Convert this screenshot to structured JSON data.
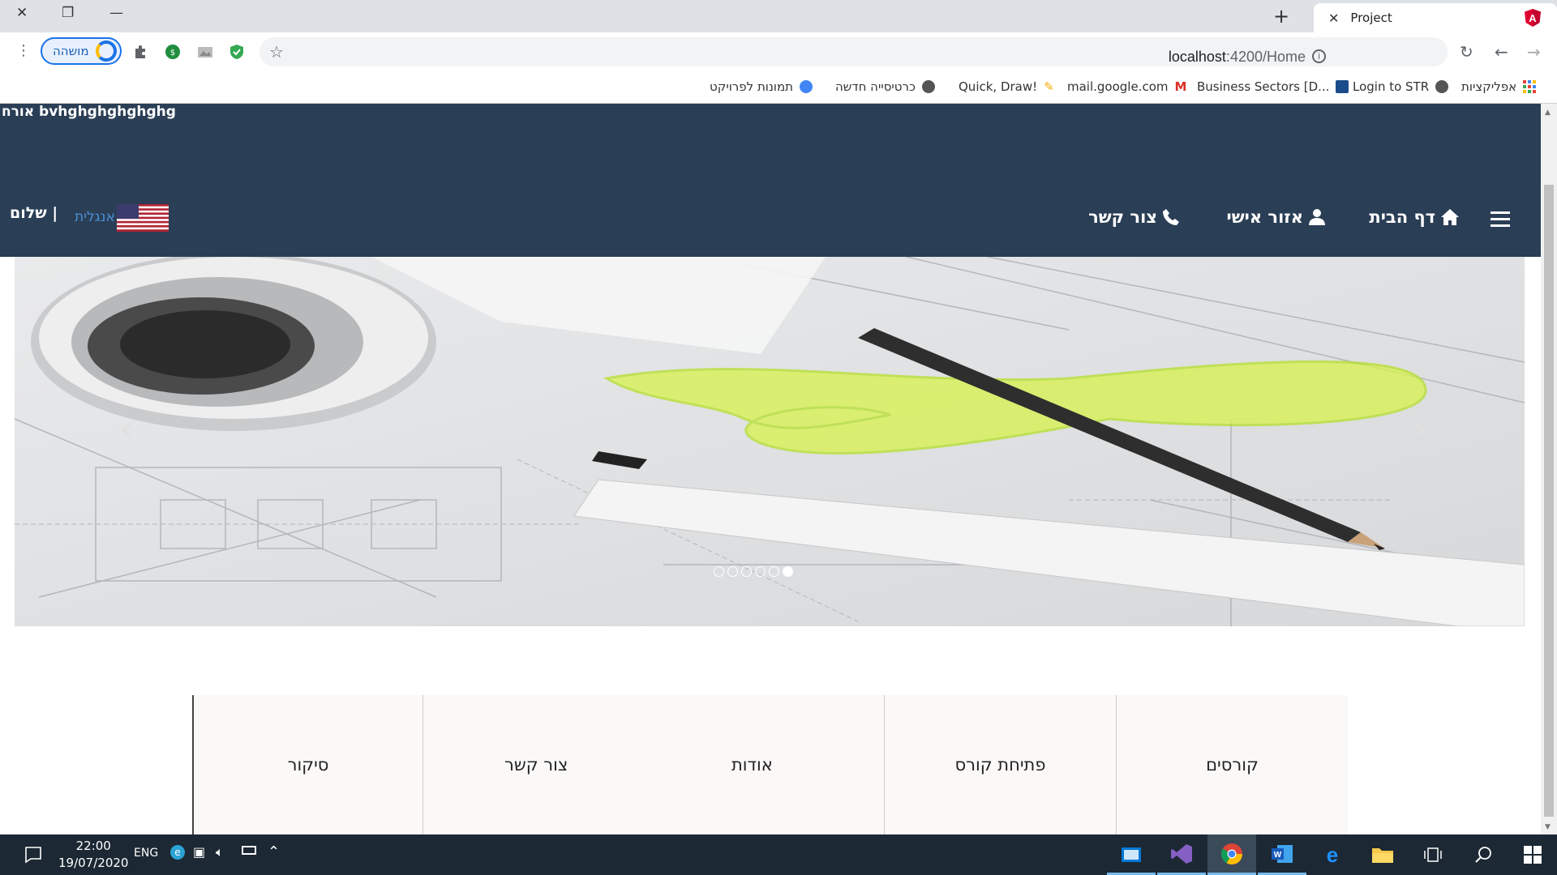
{
  "browser": {
    "tab_title": "Project",
    "url_host": "localhost",
    "url_path": ":4200/Home",
    "profile_label": "מושהה",
    "new_tab": "+",
    "bookmarks": [
      {
        "label": "אפליקציות",
        "icon": "apps-grid-icon"
      },
      {
        "label": "Login to STR",
        "icon": "globe-icon"
      },
      {
        "label": "Business Sectors [D...",
        "icon": "dnb-icon"
      },
      {
        "label": "mail.google.com",
        "icon": "gmail-icon"
      },
      {
        "label": "Quick, Draw!",
        "icon": "quickdraw-icon"
      },
      {
        "label": "כרטיסייה חדשה",
        "icon": "globe-icon"
      },
      {
        "label": "תמונות לפרויקט",
        "icon": "bot-icon"
      }
    ]
  },
  "header": {
    "user_line": "bvhghghghghghg אורח",
    "nav": [
      {
        "label": "דף הבית",
        "icon": "home-icon"
      },
      {
        "label": "אזור אישי",
        "icon": "user-icon"
      },
      {
        "label": "צור קשר",
        "icon": "phone-icon"
      }
    ],
    "language": "אנגלית",
    "greeting": "| שלום"
  },
  "carousel": {
    "slide_count": 6,
    "active_index": 5,
    "prev_glyph": "‹",
    "next_glyph": "›"
  },
  "boxes": [
    "קורסים",
    "פתיחת קורס",
    "אודות",
    "צור קשר",
    "סיקור"
  ],
  "taskbar": {
    "time": "22:00",
    "date": "19/07/2020",
    "language": "ENG"
  },
  "colors": {
    "header_bg": "#2a3e55",
    "accent": "#1a73e8",
    "taskbar_bg": "#1c2833"
  }
}
